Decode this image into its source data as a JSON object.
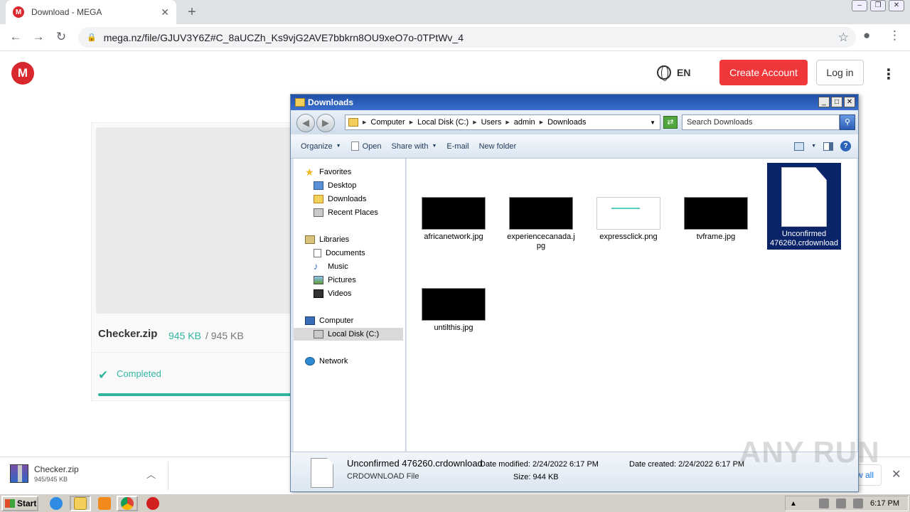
{
  "browser": {
    "tab_title": "Download - MEGA",
    "favicon_letter": "M",
    "url": "mega.nz/file/GJUV3Y6Z#C_8aUCZh_Ks9vjG2AVE7bbkrn8OU9xeO7o-0TPtWv_4"
  },
  "mega": {
    "logo_letter": "M",
    "language": "EN",
    "create_account_label": "Create Account",
    "login_label": "Log in",
    "file_name": "Checker.zip",
    "size_downloaded": "945 KB",
    "size_separator": "/",
    "size_total": "945 KB",
    "status": "Completed",
    "progress_fraction": 1.0,
    "accent_color": "#31b5a0",
    "brand_color": "#d9272e"
  },
  "download_shelf": {
    "file_name": "Checker.zip",
    "size_text": "945/945 KB",
    "show_all_label": "w all"
  },
  "explorer": {
    "title": "Downloads",
    "breadcrumbs": [
      "Computer",
      "Local Disk (C:)",
      "Users",
      "admin",
      "Downloads"
    ],
    "search_placeholder": "Search Downloads",
    "commands": {
      "organize": "Organize",
      "open": "Open",
      "share_with": "Share with",
      "email": "E-mail",
      "new_folder": "New folder"
    },
    "nav": {
      "favorites": "Favorites",
      "desktop": "Desktop",
      "downloads": "Downloads",
      "recent_places": "Recent Places",
      "libraries": "Libraries",
      "documents": "Documents",
      "music": "Music",
      "pictures": "Pictures",
      "videos": "Videos",
      "computer": "Computer",
      "local_disk": "Local Disk (C:)",
      "network": "Network"
    },
    "files": [
      {
        "name_line1": "africanetwork.jpg",
        "name_line2": ""
      },
      {
        "name_line1": "experiencecanada.j",
        "name_line2": "pg"
      },
      {
        "name_line1": "expressclick.png",
        "name_line2": ""
      },
      {
        "name_line1": "tvframe.jpg",
        "name_line2": ""
      },
      {
        "name_line1": "Unconfirmed",
        "name_line2": "476260.crdownload"
      },
      {
        "name_line1": "untilthis.jpg",
        "name_line2": ""
      }
    ],
    "details": {
      "name": "Unconfirmed 476260.crdownload",
      "type": "CRDOWNLOAD File",
      "date_modified_label": "Date modified:",
      "date_modified": "2/24/2022 6:17 PM",
      "size_label": "Size:",
      "size": "944 KB",
      "date_created_label": "Date created:",
      "date_created": "2/24/2022 6:17 PM"
    }
  },
  "taskbar": {
    "start_label": "Start",
    "clock": "6:17 PM"
  },
  "watermark": "ANY RUN"
}
